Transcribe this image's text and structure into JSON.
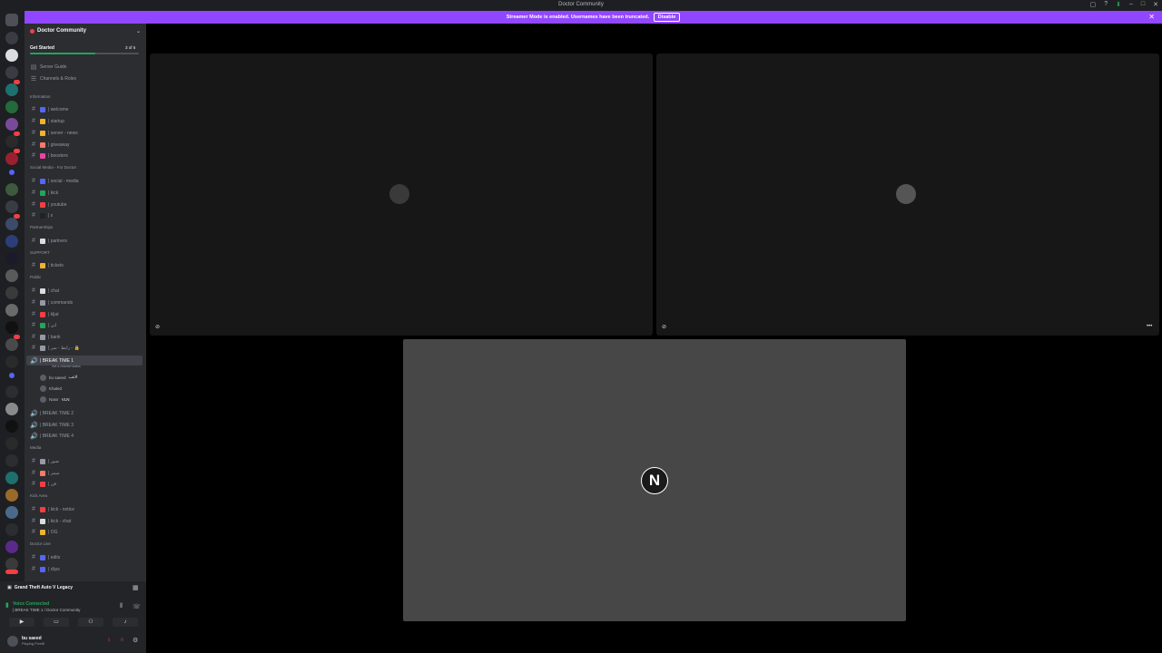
{
  "window": {
    "title": "Doctor Community"
  },
  "banner": {
    "text": "Streamer Mode is enabled. Usernames have been truncated.",
    "button_label": "Disable"
  },
  "server": {
    "name": "Doctor Community",
    "get_started": "Get Started",
    "progress_text": "3 of 5",
    "progress_fraction": 0.6,
    "guide": "Server Guide",
    "roles": "Channels & Roles"
  },
  "channels": [
    {
      "type": "category",
      "label": "Information"
    },
    {
      "type": "text",
      "label": "| welcome",
      "color": "#5865f2"
    },
    {
      "type": "text",
      "label": "| startup",
      "color": "#f0b232"
    },
    {
      "type": "text",
      "label": "| server - news",
      "color": "#f0b232"
    },
    {
      "type": "text",
      "label": "| giveaway",
      "color": "#f47b67"
    },
    {
      "type": "text",
      "label": "| boosters",
      "color": "#eb459f"
    },
    {
      "type": "category",
      "label": "Social Media - For Doctor"
    },
    {
      "type": "text",
      "label": "| social - media",
      "color": "#5865f2"
    },
    {
      "type": "text",
      "label": "| kick",
      "color": "#23a55a"
    },
    {
      "type": "text",
      "label": "| youtube",
      "color": "#f23f43"
    },
    {
      "type": "text",
      "label": "| x",
      "color": "#222222"
    },
    {
      "type": "category",
      "label": "Partnerships"
    },
    {
      "type": "text",
      "label": "| partners",
      "color": "#dbdee1"
    },
    {
      "type": "category",
      "label": "SUPPORT"
    },
    {
      "type": "text",
      "label": "| tickets",
      "color": "#f0b232"
    },
    {
      "type": "category",
      "label": "Public"
    },
    {
      "type": "text",
      "label": "| chat",
      "color": "#dbdee1"
    },
    {
      "type": "text",
      "label": "| commands",
      "color": "#949ba4"
    },
    {
      "type": "text",
      "label": "| kljat",
      "color": "#f23f43"
    },
    {
      "type": "text",
      "label": "| ابن",
      "color": "#23a55a"
    },
    {
      "type": "text",
      "label": "| bank",
      "color": "#949ba4"
    },
    {
      "type": "text",
      "label": "| رابط - سر - 🔒",
      "color": "#949ba4"
    },
    {
      "type": "voice",
      "label": "| BREAK TIME 1",
      "active": true,
      "sub": "Set a channel status"
    },
    {
      "type": "voice",
      "label": "| BREAK TIME 2"
    },
    {
      "type": "voice",
      "label": "| BREAK TIME 3"
    },
    {
      "type": "voice",
      "label": "| BREAK TIME 4"
    },
    {
      "type": "category",
      "label": "Media"
    },
    {
      "type": "text",
      "label": "| صور",
      "color": "#949ba4"
    },
    {
      "type": "text",
      "label": "| ميمز",
      "color": "#f47b67"
    },
    {
      "type": "text",
      "label": "| فن",
      "color": "#f23f43"
    },
    {
      "type": "category",
      "label": "Kick Area"
    },
    {
      "type": "text",
      "label": "| kick - notice",
      "color": "#f23f43"
    },
    {
      "type": "text",
      "label": "| kick - chat",
      "color": "#dbdee1"
    },
    {
      "type": "text",
      "label": "| OG",
      "color": "#f0b232"
    },
    {
      "type": "category",
      "label": "Doctor Live"
    },
    {
      "type": "text",
      "label": "| edits",
      "color": "#5865f2"
    },
    {
      "type": "text",
      "label": "| clips",
      "color": "#5865f2"
    }
  ],
  "voice_users": [
    {
      "name": "bu saeed",
      "tag": "لاعب"
    },
    {
      "name": "Khaled",
      "tag": ""
    },
    {
      "name": "Nasır",
      "tag": "VLN"
    }
  ],
  "voice_panel": {
    "game": "Grand Theft Auto V Legacy",
    "status": "Voice Connected",
    "channel": "| BREAK TIME 1 / Doctor Community"
  },
  "user": {
    "name": "bu saeed",
    "status": "Playing FiveM"
  },
  "stage": {
    "large_tile_initial": "N"
  },
  "colors": {
    "banner": "#9147ff",
    "connected": "#23a55a",
    "danger": "#f23f43"
  }
}
